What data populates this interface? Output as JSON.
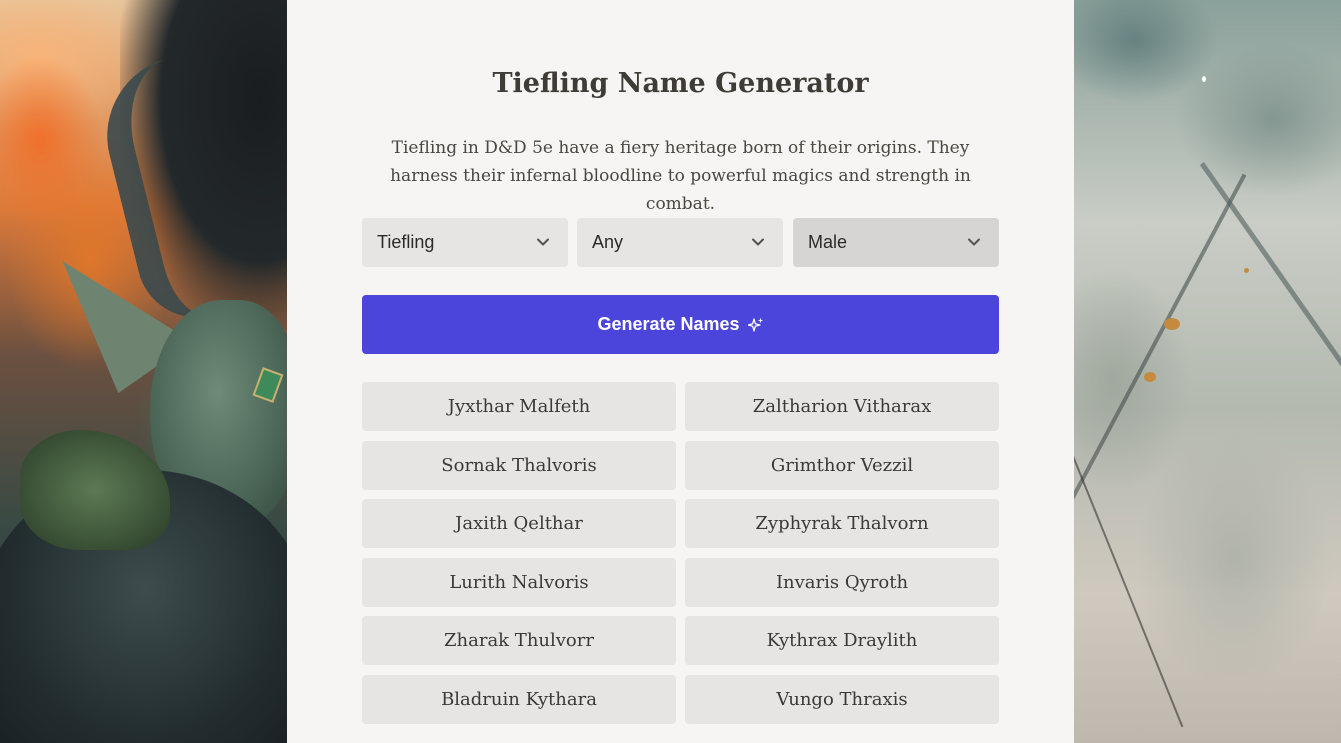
{
  "page": {
    "title": "Tiefling Name Generator",
    "description": "Tiefling in D&D 5e have a fiery heritage born of their origins. They harness their infernal bloodline to powerful magics and strength in combat."
  },
  "filters": {
    "race": "Tiefling",
    "type": "Any",
    "gender": "Male"
  },
  "generate_button": {
    "label": "Generate Names",
    "color": "#4c45dc"
  },
  "names": [
    "Jyxthar Malfeth",
    "Zaltharion Vitharax",
    "Sornak Thalvoris",
    "Grimthor Vezzil",
    "Jaxith Qelthar",
    "Zyphyrak Thalvorn",
    "Lurith Nalvoris",
    "Invaris Qyroth",
    "Zharak Thulvorr",
    "Kythrax Draylith",
    "Bladruin Kythara",
    "Vungo Thraxis"
  ]
}
